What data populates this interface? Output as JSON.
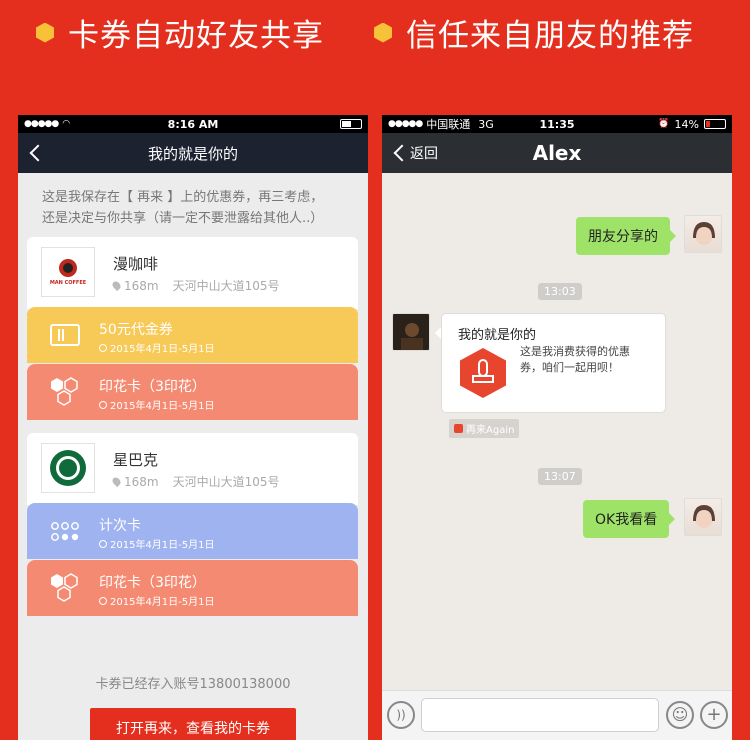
{
  "headline": {
    "left": "卡券自动好友共享",
    "right": "信任来自朋友的推荐"
  },
  "left_phone": {
    "status": {
      "time": "8:16 AM"
    },
    "nav": {
      "title": "我的就是你的"
    },
    "intro_line1": "这是我保存在【 再来 】上的优惠券，再三考虑，",
    "intro_line2": "还是决定与你共享（请一定不要泄露给其他人..）",
    "merchants": [
      {
        "name": "漫咖啡",
        "logo_text": "MAN COFFEE",
        "distance": "168m",
        "address": "天河中山大道105号"
      },
      {
        "name": "星巴克",
        "distance": "168m",
        "address": "天河中山大道105号"
      }
    ],
    "coupons": [
      {
        "title": "50元代金券",
        "date": "2015年4月1日-5月1日",
        "icon": "ticket-icon",
        "color": "#f7c957"
      },
      {
        "title": "印花卡（3印花）",
        "date": "2015年4月1日-5月1日",
        "icon": "hexagons-icon",
        "color": "#f58a73"
      },
      {
        "title": "计次卡",
        "date": "2015年4月1日-5月1日",
        "icon": "dots-icon",
        "color": "#9eb3ef"
      },
      {
        "title": "印花卡（3印花）",
        "date": "2015年4月1日-5月1日",
        "icon": "hexagons-icon",
        "color": "#f58a73"
      }
    ],
    "saved_note": "卡券已经存入账号13800138000",
    "open_button": "打开再来，查看我的卡券"
  },
  "right_phone": {
    "status": {
      "carrier": "中国联通",
      "network": "3G",
      "time": "11:35",
      "battery": "14%"
    },
    "nav": {
      "back": "返回",
      "title": "Alex"
    },
    "messages": {
      "msg1": "朋友分享的",
      "time1": "13:03",
      "card_title": "我的就是你的",
      "card_desc": "这是我消费获得的优惠券，咱们一起用呗！",
      "source": "再来Again",
      "time2": "13:07",
      "msg2": "OK我看看"
    }
  },
  "colors": {
    "brand_red": "#e52f1e",
    "bubble_green": "#9ee368",
    "nav_dark": "#1d2231"
  }
}
